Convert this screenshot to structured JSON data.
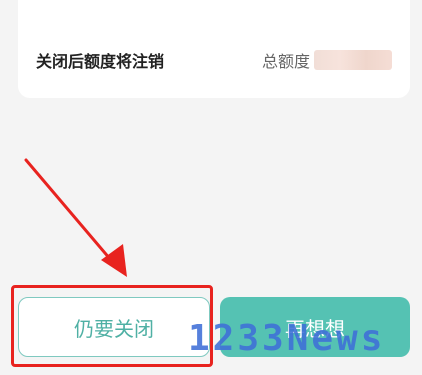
{
  "card": {
    "label": "关闭后额度将注销",
    "amount_label": "总额度"
  },
  "buttons": {
    "close": "仍要关闭",
    "think_again": "再想想"
  },
  "watermark": "1233News",
  "colors": {
    "accent": "#55c2b3",
    "annotation": "#e8231f",
    "watermark": "#3f6fd8"
  }
}
